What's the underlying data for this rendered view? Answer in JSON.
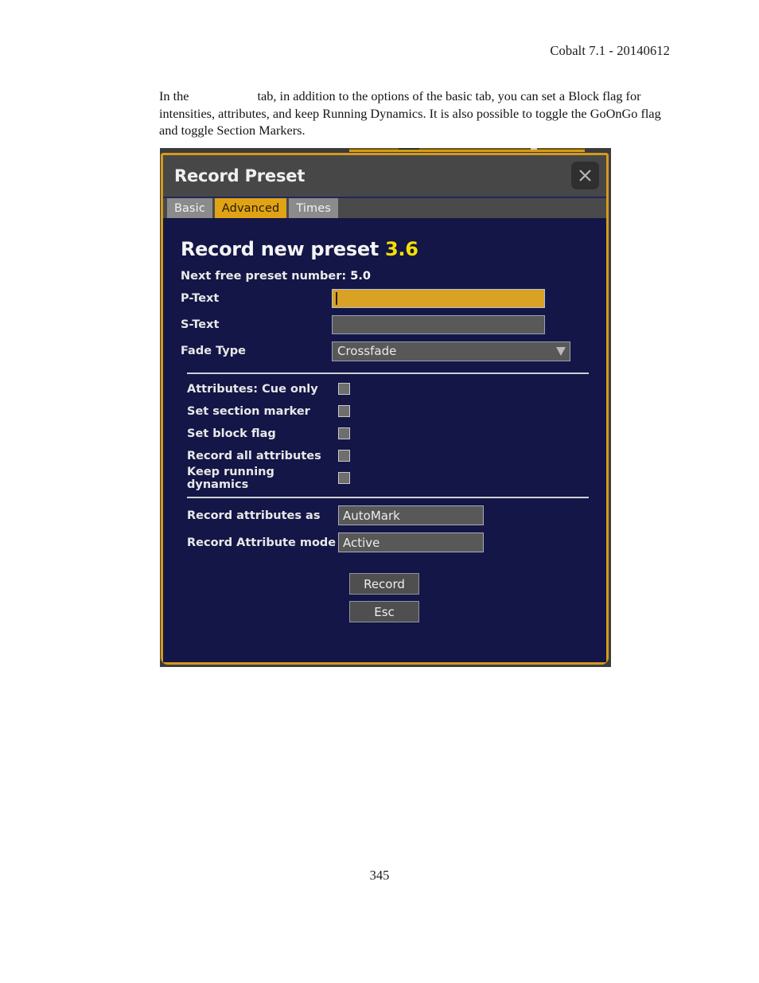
{
  "page": {
    "header": "Cobalt 7.1 - 20140612",
    "number": "345",
    "body_text_before_gap": "In the",
    "body_text_after_gap": "tab, in addition to the options of the basic tab, you can set a Block flag for intensities, attributes, and keep Running Dynamics. It is also possible to toggle the GoOnGo flag and toggle Section Markers."
  },
  "dialog": {
    "title": "Record Preset",
    "close_icon": "close-icon",
    "tabs": [
      {
        "label": "Basic",
        "active": false
      },
      {
        "label": "Advanced",
        "active": true
      },
      {
        "label": "Times",
        "active": false
      }
    ],
    "heading_text": "Record new preset",
    "heading_number": "3.6",
    "next_free_label": "Next free preset number:",
    "next_free_value": "5.0",
    "fields": [
      {
        "label": "P-Text",
        "value": "",
        "placeholder": "",
        "style": "gold",
        "focused": true
      },
      {
        "label": "S-Text",
        "value": "",
        "placeholder": "",
        "style": "plain",
        "focused": false
      }
    ],
    "fade_type": {
      "label": "Fade Type",
      "value": "Crossfade",
      "arrow_icon": "chevron-down-icon"
    },
    "checkboxes": [
      {
        "label": "Attributes: Cue only",
        "checked": false
      },
      {
        "label": "Set section marker",
        "checked": false
      },
      {
        "label": "Set block flag",
        "checked": false
      },
      {
        "label": "Record all attributes",
        "checked": false
      },
      {
        "label": "Keep running dynamics",
        "checked": false
      }
    ],
    "selectors": [
      {
        "label": "Record attributes as",
        "value": "AutoMark"
      },
      {
        "label": "Record Attribute mode",
        "value": "Active"
      }
    ],
    "buttons": [
      {
        "label": "Record"
      },
      {
        "label": "Esc"
      }
    ],
    "colors": {
      "border": "#d49a1b",
      "body_bg": "#131646",
      "titlebar_bg": "#474747",
      "active_tab": "#e0a315",
      "inactive_tab": "#8b8b8b",
      "gold_input": "#d9a225",
      "heading_number": "#f6e000"
    }
  }
}
